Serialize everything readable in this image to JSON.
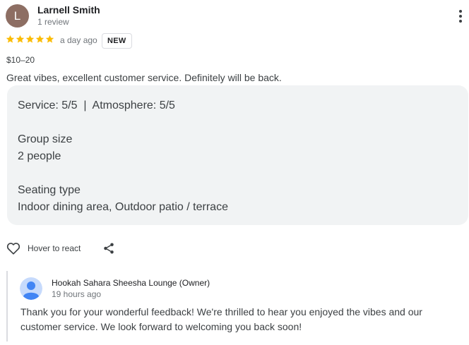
{
  "reviewer": {
    "initial": "L",
    "name": "Larnell Smith",
    "review_count": "1 review",
    "avatar_color": "#8d6e63"
  },
  "review": {
    "rating": 5,
    "rating_max": 5,
    "star_color": "#fbbc04",
    "time": "a day ago",
    "badge": "NEW",
    "price": "$10–20",
    "text": "Great vibes, excellent customer service. Definitely will be back."
  },
  "details": {
    "ratings_line": "Service: 5/5  |  Atmosphere: 5/5",
    "group_size_label": "Group size",
    "group_size_value": "2 people",
    "seating_label": "Seating type",
    "seating_value": "Indoor dining area, Outdoor patio / terrace"
  },
  "actions": {
    "react_label": "Hover to react",
    "react_icon": "heart-outline-icon",
    "share_icon": "share-icon",
    "more_icon": "more-vertical-icon"
  },
  "owner_reply": {
    "name": "Hookah Sahara Sheesha Lounge (Owner)",
    "time": "19 hours ago",
    "text": "Thank you for your wonderful feedback! We're thrilled to hear you enjoyed the vibes and our customer service. We look forward to welcoming you back soon!",
    "avatar_icon": "default-person-avatar-icon"
  }
}
